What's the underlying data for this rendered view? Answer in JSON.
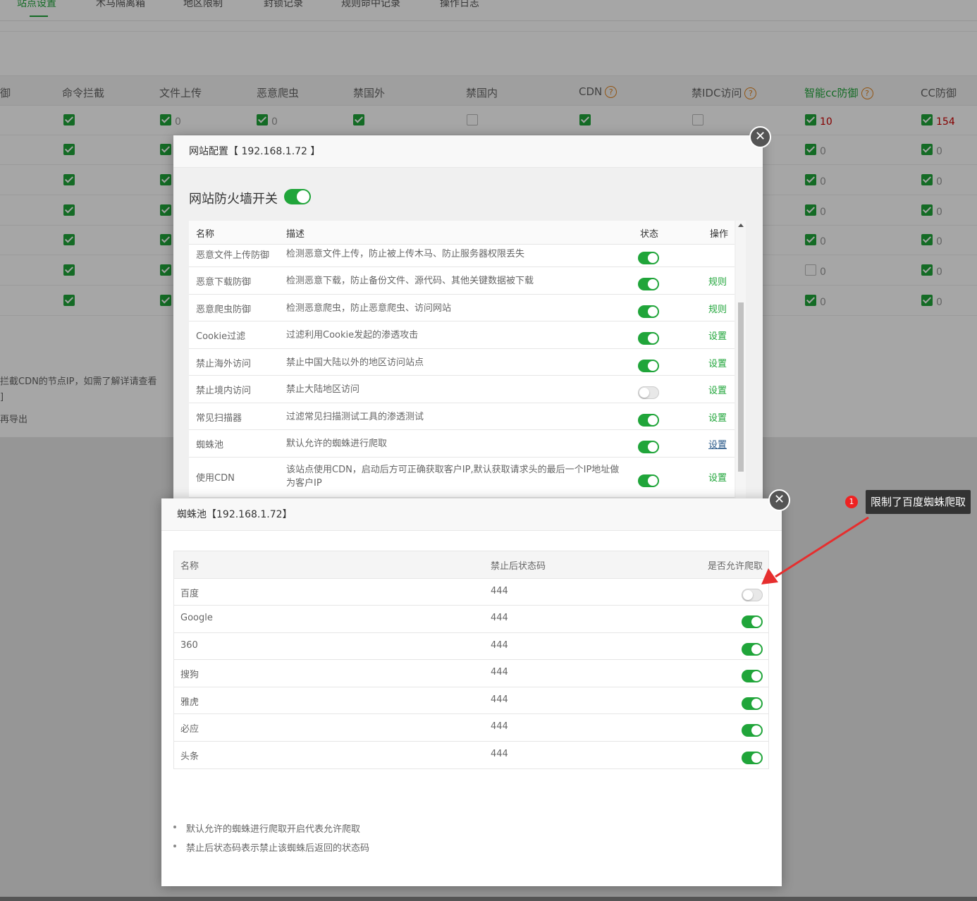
{
  "tabs": [
    "站点设置",
    "木马隔离箱",
    "地区限制",
    "封锁记录",
    "规则命中记录",
    "操作日志"
  ],
  "main_table": {
    "headers": [
      "御",
      "命令拦截",
      "文件上传",
      "恶意爬虫",
      "禁国外",
      "禁国内",
      "CDN",
      "禁IDC访问",
      "智能cc防御",
      "CC防御"
    ],
    "first_row_values": {
      "文件上传": "0",
      "恶意爬虫": "0",
      "智能cc防御": "10",
      "CC防御": "154"
    },
    "other_row_values": "0"
  },
  "notes": [
    "拦截CDN的节点IP，如需了解详请查看",
    "]",
    "再导出"
  ],
  "firewall_modal": {
    "title": "网站配置【 192.168.1.72 】",
    "firewall_switch_label": "网站防火墙开关",
    "firewall_switch_on": true,
    "columns": [
      "名称",
      "描述",
      "状态",
      "操作"
    ],
    "rows": [
      {
        "name": "恶意文件上传防御",
        "desc": "检测恶意文件上传，防止被上传木马、防止服务器权限丢失",
        "on": true,
        "op": ""
      },
      {
        "name": "恶意下载防御",
        "desc": "检测恶意下载，防止备份文件、源代码、其他关键数据被下载",
        "on": true,
        "op": "规则"
      },
      {
        "name": "恶意爬虫防御",
        "desc": "检测恶意爬虫，防止恶意爬虫、访问网站",
        "on": true,
        "op": "规则"
      },
      {
        "name": "Cookie过滤",
        "desc": "过滤利用Cookie发起的渗透攻击",
        "on": true,
        "op": "设置"
      },
      {
        "name": "禁止海外访问",
        "desc": "禁止中国大陆以外的地区访问站点",
        "on": true,
        "op": "设置"
      },
      {
        "name": "禁止境内访问",
        "desc": "禁止大陆地区访问",
        "on": false,
        "op": "设置"
      },
      {
        "name": "常见扫描器",
        "desc": "过滤常见扫描测试工具的渗透测试",
        "on": true,
        "op": "设置"
      },
      {
        "name": "蜘蛛池",
        "desc": "默认允许的蜘蛛进行爬取",
        "on": true,
        "op": "设置"
      },
      {
        "name": "使用CDN",
        "desc": "该站点使用CDN，启动后方可正确获取客户IP,默认获取请求头的最后一个IP地址做为客户IP",
        "on": true,
        "op": "设置"
      }
    ]
  },
  "spider_modal": {
    "title": "蜘蛛池【192.168.1.72】",
    "columns": [
      "名称",
      "禁止后状态码",
      "是否允许爬取"
    ],
    "rows": [
      {
        "name": "百度",
        "code": "444",
        "allowed": false
      },
      {
        "name": "Google",
        "code": "444",
        "allowed": true
      },
      {
        "name": "360",
        "code": "444",
        "allowed": true
      },
      {
        "name": "搜狗",
        "code": "444",
        "allowed": true
      },
      {
        "name": "雅虎",
        "code": "444",
        "allowed": true
      },
      {
        "name": "必应",
        "code": "444",
        "allowed": true
      },
      {
        "name": "头条",
        "code": "444",
        "allowed": true
      }
    ],
    "tips": [
      "默认允许的蜘蛛进行爬取开启代表允许爬取",
      "禁止后状态码表示禁止该蜘蛛后返回的状态码"
    ]
  },
  "annotation": {
    "badge": "1",
    "text": "限制了百度蜘蛛爬取"
  },
  "colors": {
    "accent": "#20a53a",
    "warning": "#e0821d",
    "danger": "#cc0000",
    "annotation_arrow": "#e62e2e"
  },
  "icons": {
    "close": "close-icon",
    "help": "question-icon",
    "check": "checkbox-icon"
  }
}
